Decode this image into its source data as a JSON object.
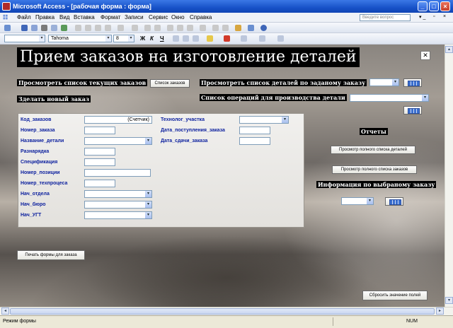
{
  "window": {
    "title": "Microsoft Access - [рабочая форма : форма]"
  },
  "menu": {
    "items": [
      "Файл",
      "Правка",
      "Вид",
      "Вставка",
      "Формат",
      "Записи",
      "Сервис",
      "Окно",
      "Справка"
    ],
    "help_placeholder": "Введите вопрос"
  },
  "format_toolbar": {
    "font_name": "Tahoma",
    "font_size": "8",
    "bold": "Ж",
    "italic": "К",
    "underline": "Ч"
  },
  "form": {
    "heading": "Прием заказов на изготовление деталей",
    "view_orders_label": "Просмотреть список текущих заказов",
    "view_orders_button": "Список заказов",
    "view_details_by_order_label": "Просмотреть список деталей по заданому заказу",
    "new_order_label": "Зделать новый заказ",
    "operations_label": "Список операций для производства детали",
    "reports_label": "Отчеты",
    "report_details_button": "Просмотр полного списка деталей",
    "report_orders_button": "Просмотр полного списка заказов",
    "order_info_label": "Информация по выбраному заказу",
    "print_button": "Печать формы для  заказа",
    "reset_button": "Сбросить значение полей",
    "fields_left": [
      {
        "label": "Код_заказов",
        "value": "(Счетчик)"
      },
      {
        "label": "Номер_заказа",
        "value": ""
      },
      {
        "label": "Название_детали",
        "value": ""
      },
      {
        "label": "Разнарядка",
        "value": ""
      },
      {
        "label": "Спецификация",
        "value": ""
      },
      {
        "label": "Номер_позиции",
        "value": ""
      },
      {
        "label": "Номер_техпроцеса",
        "value": ""
      },
      {
        "label": "Нач_отдела",
        "value": ""
      },
      {
        "label": "Нач_бюро",
        "value": ""
      },
      {
        "label": "Нач_УГТ",
        "value": ""
      }
    ],
    "fields_right": [
      {
        "label": "Технолог_участка",
        "value": ""
      },
      {
        "label": "Дата_поступления_заказа",
        "value": ""
      },
      {
        "label": "Дата_сдачи_заказа",
        "value": ""
      }
    ]
  },
  "statusbar": {
    "mode": "Режим формы",
    "num": "NUM"
  }
}
